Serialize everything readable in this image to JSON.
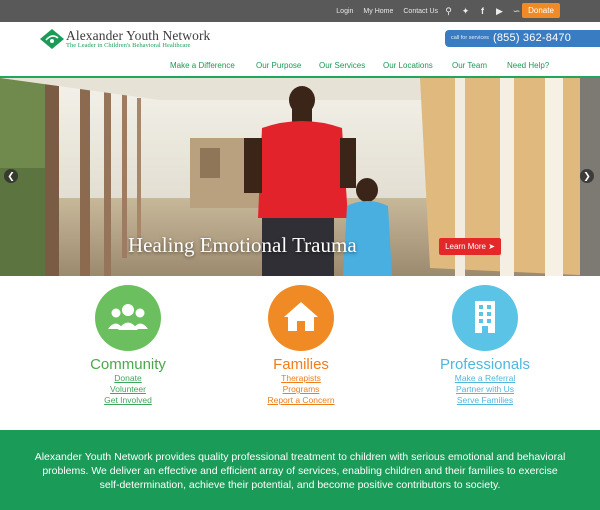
{
  "topbar": {
    "links": [
      "Login",
      "My Home",
      "Contact Us"
    ],
    "social": [
      "search-icon",
      "twitter-icon",
      "facebook-icon",
      "youtube-icon",
      "rss-icon"
    ],
    "donate_label": "Donate"
  },
  "header": {
    "logo_title": "Alexander Youth Network",
    "logo_tagline": "The Leader in Children's Behavioral Healthcare",
    "call_label": "call for services",
    "phone": "(855) 362-8470"
  },
  "nav": {
    "items": [
      "Make a Difference",
      "Our Purpose",
      "Our Services",
      "Our Locations",
      "Our Team",
      "Need Help?"
    ]
  },
  "hero": {
    "title": "Healing Emotional Trauma",
    "cta_label": "Learn More"
  },
  "pillars": [
    {
      "title": "Community",
      "icon": "users-icon",
      "color": "#6cbf5f",
      "links": [
        "Donate",
        "Volunteer",
        "Get Involved"
      ]
    },
    {
      "title": "Families",
      "icon": "home-icon",
      "color": "#f08a24",
      "links": [
        "Therapists",
        "Programs",
        "Report a Concern"
      ]
    },
    {
      "title": "Professionals",
      "icon": "building-icon",
      "color": "#5bc3e6",
      "links": [
        "Make a Referral",
        "Partner with Us",
        "Serve Families"
      ]
    }
  ],
  "mission": "Alexander Youth Network provides quality professional treatment to children with serious emotional and behavioral problems. We deliver an effective and efficient array of services, enabling children and their families to exercise self-determination, achieve their potential, and become positive contributors to society.",
  "colors": {
    "brand_green": "#1a9b57",
    "donate_orange": "#f08a24",
    "phone_blue": "#3a7cc2",
    "cta_red": "#e4282a"
  }
}
